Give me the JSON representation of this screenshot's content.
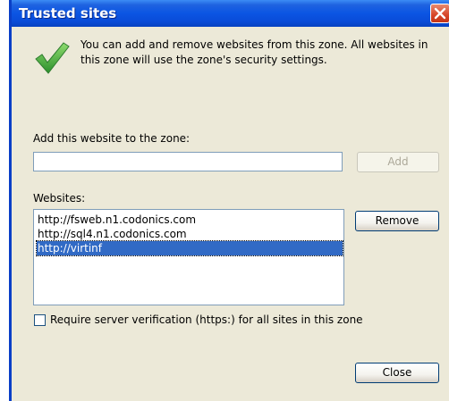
{
  "dialog": {
    "title": "Trusted sites",
    "intro": "You can add and remove websites from this zone. All websites in this zone will use the zone's security settings."
  },
  "add_section": {
    "label": "Add this website to the zone:",
    "input_value": "",
    "add_button": "Add"
  },
  "websites": {
    "label": "Websites:",
    "items": [
      {
        "url": "http://fsweb.n1.codonics.com",
        "selected": false
      },
      {
        "url": "http://sql4.n1.codonics.com",
        "selected": false
      },
      {
        "url": "http://virtinf",
        "selected": true
      }
    ],
    "remove_button": "Remove"
  },
  "verification": {
    "label": "Require server verification (https:) for all sites in this zone",
    "checked": false
  },
  "close_button": "Close",
  "icons": {
    "titlebar_close": "close-icon",
    "info": "checkmark-icon"
  },
  "colors": {
    "titlebar": "#0b55e3",
    "selection": "#316ac5",
    "checkmark": "#3aa63a",
    "close": "#d6462a"
  }
}
